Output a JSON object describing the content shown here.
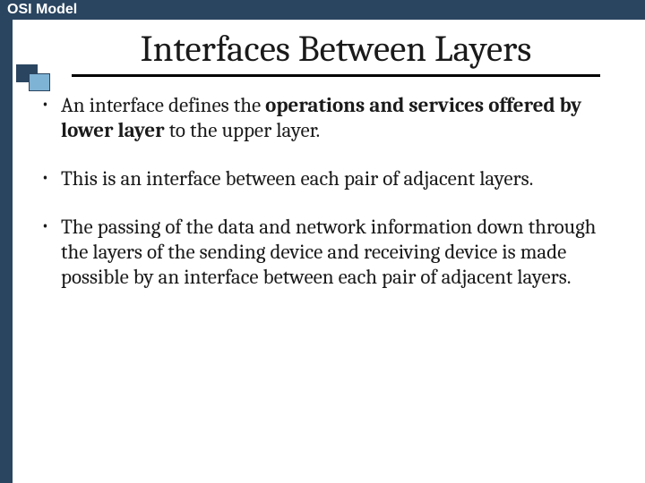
{
  "header": {
    "label": "OSI Model"
  },
  "title": "Interfaces Between Layers",
  "bullets": [
    {
      "pre": "An interface defines the ",
      "bold": "operations and services offered by lower layer",
      "post": " to the upper layer."
    },
    {
      "pre": "This is an interface between each pair of adjacent layers.",
      "bold": "",
      "post": ""
    },
    {
      "pre": "The passing of the data and network information down through the layers of the sending device and receiving device is made possible by an interface between each pair of adjacent layers.",
      "bold": "",
      "post": ""
    }
  ],
  "colors": {
    "headerBg": "#2a4560",
    "accentSquare": "#7fb3d5"
  }
}
